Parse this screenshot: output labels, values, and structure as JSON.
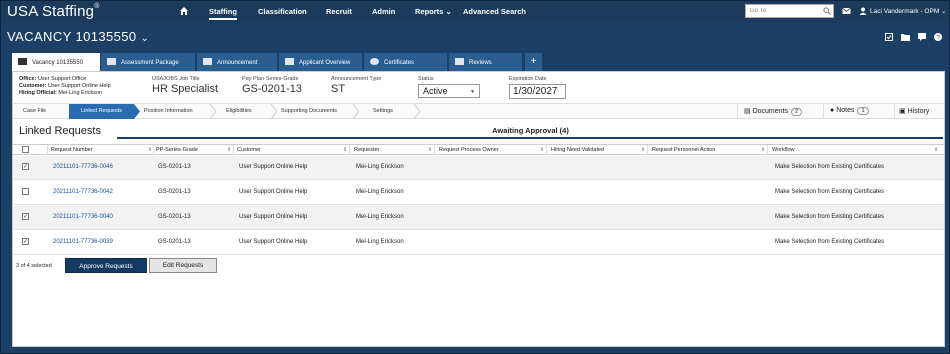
{
  "app": {
    "brand": "USA Staffing",
    "brand_mark": "®"
  },
  "nav": {
    "items": [
      "Staffing",
      "Classification",
      "Recruit",
      "Admin",
      "Reports",
      "Advanced Search"
    ],
    "active": "Staffing",
    "goto_placeholder": "Go To",
    "user": "Laci Vandermark - OPM"
  },
  "vacancy": {
    "title": "VACANCY 10135550"
  },
  "tabs": [
    {
      "label": "Vacancy 10135550",
      "icon": "folder-icon"
    },
    {
      "label": "Assessment Package",
      "icon": "document-icon"
    },
    {
      "label": "Announcement",
      "icon": "megaphone-icon"
    },
    {
      "label": "Applicant Overview",
      "icon": "users-icon"
    },
    {
      "label": "Certificates",
      "icon": "certificate-icon"
    },
    {
      "label": "Reviews",
      "icon": "thumbs-up-icon"
    }
  ],
  "tab_add": "+",
  "summary": {
    "office_label": "Office:",
    "office": "User Support Office",
    "customer_label": "Customer:",
    "customer": "User Support Online Help",
    "hiring_label": "Hiring Official:",
    "hiring": "Mei-Ling Erickson"
  },
  "fields": {
    "job_title_label": "USAJOBS Job Title",
    "job_title": "HR Specialist",
    "pps_label": "Pay Plan-Series-Grade",
    "pps": "GS-0201-13",
    "ann_type_label": "Announcement Type",
    "ann_type": "ST",
    "status_label": "Status",
    "status": "Active",
    "exp_label": "Expiration Date",
    "exp": "1/30/2027"
  },
  "steps": [
    "Case File",
    "Linked Requests",
    "Position Information",
    "Eligibilities",
    "Supporting Documents",
    "Settings"
  ],
  "side_tabs": {
    "documents": "Documents",
    "documents_count": "2",
    "notes": "Notes",
    "notes_count": "1",
    "history": "History"
  },
  "linked": {
    "title": "Linked Requests",
    "awaiting": "Awaiting Approval (4)",
    "columns": [
      "Request Number",
      "PP-Series-Grade",
      "Customer",
      "Requester",
      "Request Process Owner",
      "Hiring Need Validated",
      "Request Personnel Action",
      "Workflow"
    ],
    "rows": [
      {
        "checked": true,
        "number": "20211101-77736-0046",
        "pps": "GS-0201-13",
        "customer": "User Support Online Help",
        "requester": "Mei-Ling Erickson",
        "owner": "",
        "validated": "",
        "action": "",
        "workflow": "Make Selection from Existing Certificates"
      },
      {
        "checked": false,
        "number": "20211101-77736-0042",
        "pps": "GS-0201-13",
        "customer": "User Support Online Help",
        "requester": "Mei-Ling Erickson",
        "owner": "",
        "validated": "",
        "action": "",
        "workflow": "Make Selection from Existing Certificates"
      },
      {
        "checked": true,
        "number": "20211101-77736-0040",
        "pps": "GS-0201-13",
        "customer": "User Support Online Help",
        "requester": "Mei-Ling Erickson",
        "owner": "",
        "validated": "",
        "action": "",
        "workflow": "Make Selection from Existing Certificates"
      },
      {
        "checked": true,
        "number": "20211101-77736-0039",
        "pps": "GS-0201-13",
        "customer": "User Support Online Help",
        "requester": "Mei-Ling Erickson",
        "owner": "",
        "validated": "",
        "action": "",
        "workflow": "Make Selection from Existing Certificates"
      }
    ],
    "selected_count": "3 of 4 selected",
    "approve_label": "Approve Requests",
    "edit_label": "Edit Requests"
  },
  "colors": {
    "navy": "#1b3a5c",
    "accent": "#2a6ab0",
    "link": "#1a4f8f"
  }
}
